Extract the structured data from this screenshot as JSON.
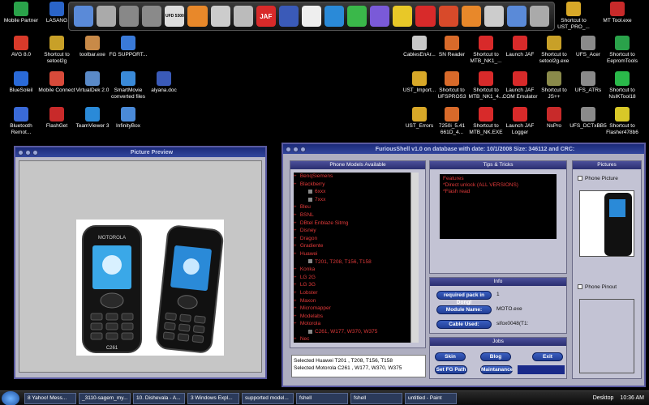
{
  "desktop": {
    "left_icons": [
      {
        "label": "Mobile Partner",
        "color": "#2aa24a"
      },
      {
        "label": "LASANG",
        "color": "#2a64c8"
      },
      {
        "label": "AVG 8.0",
        "color": "#d83a2a"
      },
      {
        "label": "Shortcut to setool2g",
        "color": "#c8a028"
      },
      {
        "label": "toolbar.exe",
        "color": "#c88a48"
      },
      {
        "label": "FG SUPPORT...",
        "color": "#3a7ad8"
      },
      {
        "label": "BlueSoleil",
        "color": "#2a6ad8"
      },
      {
        "label": "Mobile Connect",
        "color": "#d84a3a"
      },
      {
        "label": "VirtualDek 2.0",
        "color": "#5a8ac8"
      },
      {
        "label": "SmartMovie converted files",
        "color": "#3a8ad8"
      },
      {
        "label": "alyana.doc",
        "color": "#3a5ab8"
      },
      {
        "label": "Bluetooth Remot...",
        "color": "#3a6ad8"
      },
      {
        "label": "FlashGet",
        "color": "#c82a2a"
      },
      {
        "label": "TeamViewer 3",
        "color": "#2a8ad8"
      },
      {
        "label": "InfinityBox",
        "color": "#4a8ad8"
      }
    ],
    "right_icons": [
      {
        "label": "Shortcut to UST_PRO_...",
        "color": "#d8a828"
      },
      {
        "label": "MT Tool.exe",
        "color": "#c82a2a"
      },
      {
        "label": "CablesEnAr...",
        "color": "#c8c8c8"
      },
      {
        "label": "SN Reader",
        "color": "#d86a2a"
      },
      {
        "label": "Shortcut to MTB_NK1_...",
        "color": "#d82a2a"
      },
      {
        "label": "Launch JAF",
        "color": "#d82a2a"
      },
      {
        "label": "Shortcut to setool2g.exe",
        "color": "#c8a028"
      },
      {
        "label": "UFS_Acer",
        "color": "#8a8a8a"
      },
      {
        "label": "Shortcut to EepromTools",
        "color": "#2aa24a"
      },
      {
        "label": "UST_Import...",
        "color": "#d8a828"
      },
      {
        "label": "Shortcut to UFSPROS3",
        "color": "#d86a2a"
      },
      {
        "label": "Shortcut to MTB_NK1_4...",
        "color": "#d82a2a"
      },
      {
        "label": "Launch JAF COM Emulator",
        "color": "#d82a2a"
      },
      {
        "label": "Shortcut to JS++",
        "color": "#8a8a4a"
      },
      {
        "label": "UFS_ATRs",
        "color": "#8a8a8a"
      },
      {
        "label": "Shortcut to NsIKTool18",
        "color": "#2ab84a"
      },
      {
        "label": "UST_Errors",
        "color": "#d8a828"
      },
      {
        "label": "7250i_5.41 661D_4...",
        "color": "#d86a2a"
      },
      {
        "label": "Shortcut to MTB_NK.EXE",
        "color": "#d82a2a"
      },
      {
        "label": "Launch JAF Logger",
        "color": "#d82a2a"
      },
      {
        "label": "NsPro",
        "color": "#c82a2a"
      },
      {
        "label": "UFS_DCTxBB5",
        "color": "#8a8a8a"
      },
      {
        "label": "Shortcut to Flasher478b6",
        "color": "#d8c828"
      }
    ]
  },
  "dock": {
    "items": [
      {
        "icon": "computer-icon",
        "color": "#5a8ad8"
      },
      {
        "icon": "network-icon",
        "color": "#aaaaaa"
      },
      {
        "icon": "phone-tool-icon",
        "color": "#888888"
      },
      {
        "icon": "phone-icon",
        "color": "#8a8a8a"
      },
      {
        "icon": "ufd-icon",
        "color": "#dddddd"
      },
      {
        "icon": "orange-cube-icon",
        "color": "#e8882a"
      },
      {
        "icon": "usb-icon",
        "color": "#cccccc"
      },
      {
        "icon": "tools-icon",
        "color": "#bbbbbb"
      },
      {
        "icon": "jaf-icon",
        "color": "#d82a2a"
      },
      {
        "icon": "infinity-icon",
        "color": "#3a5ab8"
      },
      {
        "icon": "cellphone-icon",
        "color": "#eeeeee"
      },
      {
        "icon": "globe-icon",
        "color": "#2a8ad8"
      },
      {
        "icon": "sync-icon",
        "color": "#3ab84a"
      },
      {
        "icon": "swirl-icon",
        "color": "#7a5ad8"
      },
      {
        "icon": "mascot-icon",
        "color": "#e8c828"
      },
      {
        "icon": "ef-icon",
        "color": "#d82a2a"
      },
      {
        "icon": "wrench-icon",
        "color": "#d84a2a"
      },
      {
        "icon": "download-icon",
        "color": "#e8882a"
      },
      {
        "icon": "wand-icon",
        "color": "#cccccc"
      },
      {
        "icon": "gear-icon",
        "color": "#5a8ad8"
      },
      {
        "icon": "recycle-bin-icon",
        "color": "#aaaaaa"
      }
    ],
    "labels": {
      "ufd": "UFD 5300",
      "jaf": "JAF"
    }
  },
  "picture_preview": {
    "title": "Picture Preview",
    "phone_brand": "MOTOROLA",
    "phone_model": "C261"
  },
  "furious_shell": {
    "title": "FuriousShell v1.0 on database with date: 10/1/2008 Size: 346112 and CRC:",
    "phone_models_header": "Phone Models Available",
    "tree": [
      {
        "label": "BenqSiemens",
        "level": 0
      },
      {
        "label": "Blackberry",
        "level": 0
      },
      {
        "label": "6xxx",
        "level": 1
      },
      {
        "label": "7xxx",
        "level": 1
      },
      {
        "label": "Bleu",
        "level": 0
      },
      {
        "label": "BSNL",
        "level": 0
      },
      {
        "label": "DBtel Enblaze Sitmg",
        "level": 0
      },
      {
        "label": "Disney",
        "level": 0
      },
      {
        "label": "Dragon",
        "level": 0
      },
      {
        "label": "Gradiente",
        "level": 0
      },
      {
        "label": "Huawei",
        "level": 0
      },
      {
        "label": "T201, T208, T156, T158",
        "level": 1
      },
      {
        "label": "Konka",
        "level": 0
      },
      {
        "label": "LG 2G",
        "level": 0
      },
      {
        "label": "LG 3G",
        "level": 0
      },
      {
        "label": "Lobster",
        "level": 0
      },
      {
        "label": "Maxon",
        "level": 0
      },
      {
        "label": "Micromapper",
        "level": 0
      },
      {
        "label": "Modelabs",
        "level": 0
      },
      {
        "label": "Motorola",
        "level": 0
      },
      {
        "label": "C261, W177, W370, W375",
        "level": 1
      },
      {
        "label": "Nec",
        "level": 0
      }
    ],
    "selected": [
      "Selected Huawei T201 , T208, T156, T158",
      "Selected Motorola C261 , W177, W370, W375"
    ],
    "tips_header": "Tips & Tricks",
    "tips": [
      "Features",
      "*Direct unlock (ALL VERSIONS)",
      "*Flash read"
    ],
    "info_header": "Info",
    "info": [
      {
        "button": "required pack in Dongl",
        "value": "1"
      },
      {
        "button": "Module Name:",
        "value": "MOTO.exe"
      },
      {
        "button": "Cable Used:",
        "value": "sifox0048(T1:"
      }
    ],
    "jobs_header": "Jobs",
    "jobs_buttons": {
      "skin": "Skin",
      "blog": "Blog",
      "exit": "Exit",
      "set_fg_path": "Set FG Path",
      "maintanance": "Maintanance"
    },
    "pictures_header": "Pictures",
    "phone_picture_label": "Phone Picture",
    "phone_pinout_label": "Phone Pinout"
  },
  "taskbar": {
    "buttons": [
      "8 Yahoo! Mess...",
      "_3110-sagem_my...",
      "10. Dishevala - A...",
      "3 Windows Expl...",
      "supported model...",
      "fshell",
      "fshell",
      "untitled - Paint"
    ],
    "desktop_label": "Desktop",
    "clock": "10:36 AM"
  }
}
